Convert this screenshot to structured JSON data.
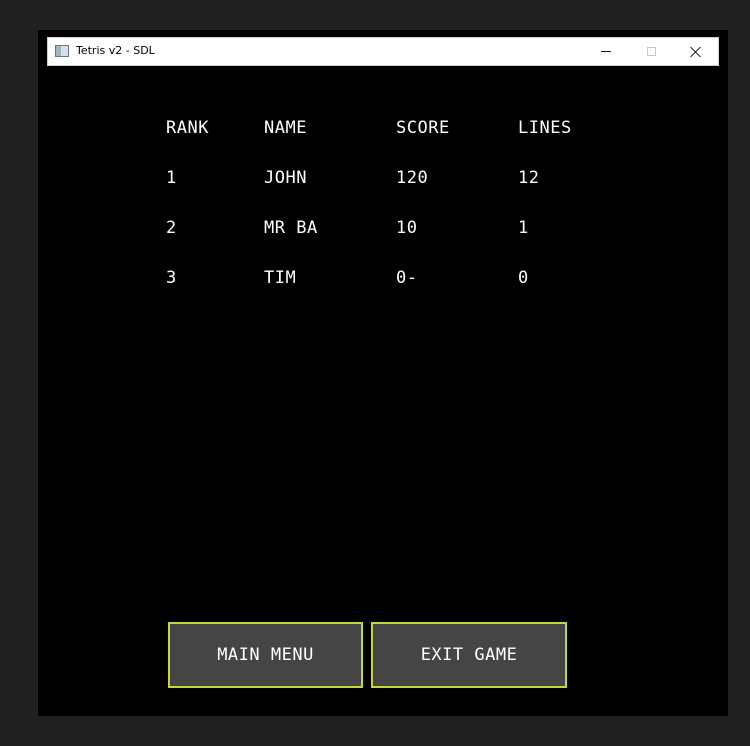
{
  "window": {
    "title": "Tetris v2 - SDL"
  },
  "leaderboard": {
    "headers": {
      "rank": "RANK",
      "name": "NAME",
      "score": "SCORE",
      "lines": "LINES"
    },
    "rows": [
      {
        "rank": "1",
        "name": "JOHN",
        "score": "120",
        "lines": "12"
      },
      {
        "rank": "2",
        "name": "MR BA",
        "score": "10",
        "lines": "1"
      },
      {
        "rank": "3",
        "name": "TIM",
        "score": "0-",
        "lines": "0"
      }
    ]
  },
  "buttons": {
    "main_menu": "MAIN MENU",
    "exit_game": "EXIT GAME"
  },
  "colors": {
    "background": "#000000",
    "button_fill": "#454545",
    "button_border": "#c8d63a",
    "text": "#ffffff"
  },
  "icons": {
    "app": "app-window-icon",
    "minimize": "minimize-icon",
    "maximize": "maximize-icon",
    "close": "close-icon"
  }
}
